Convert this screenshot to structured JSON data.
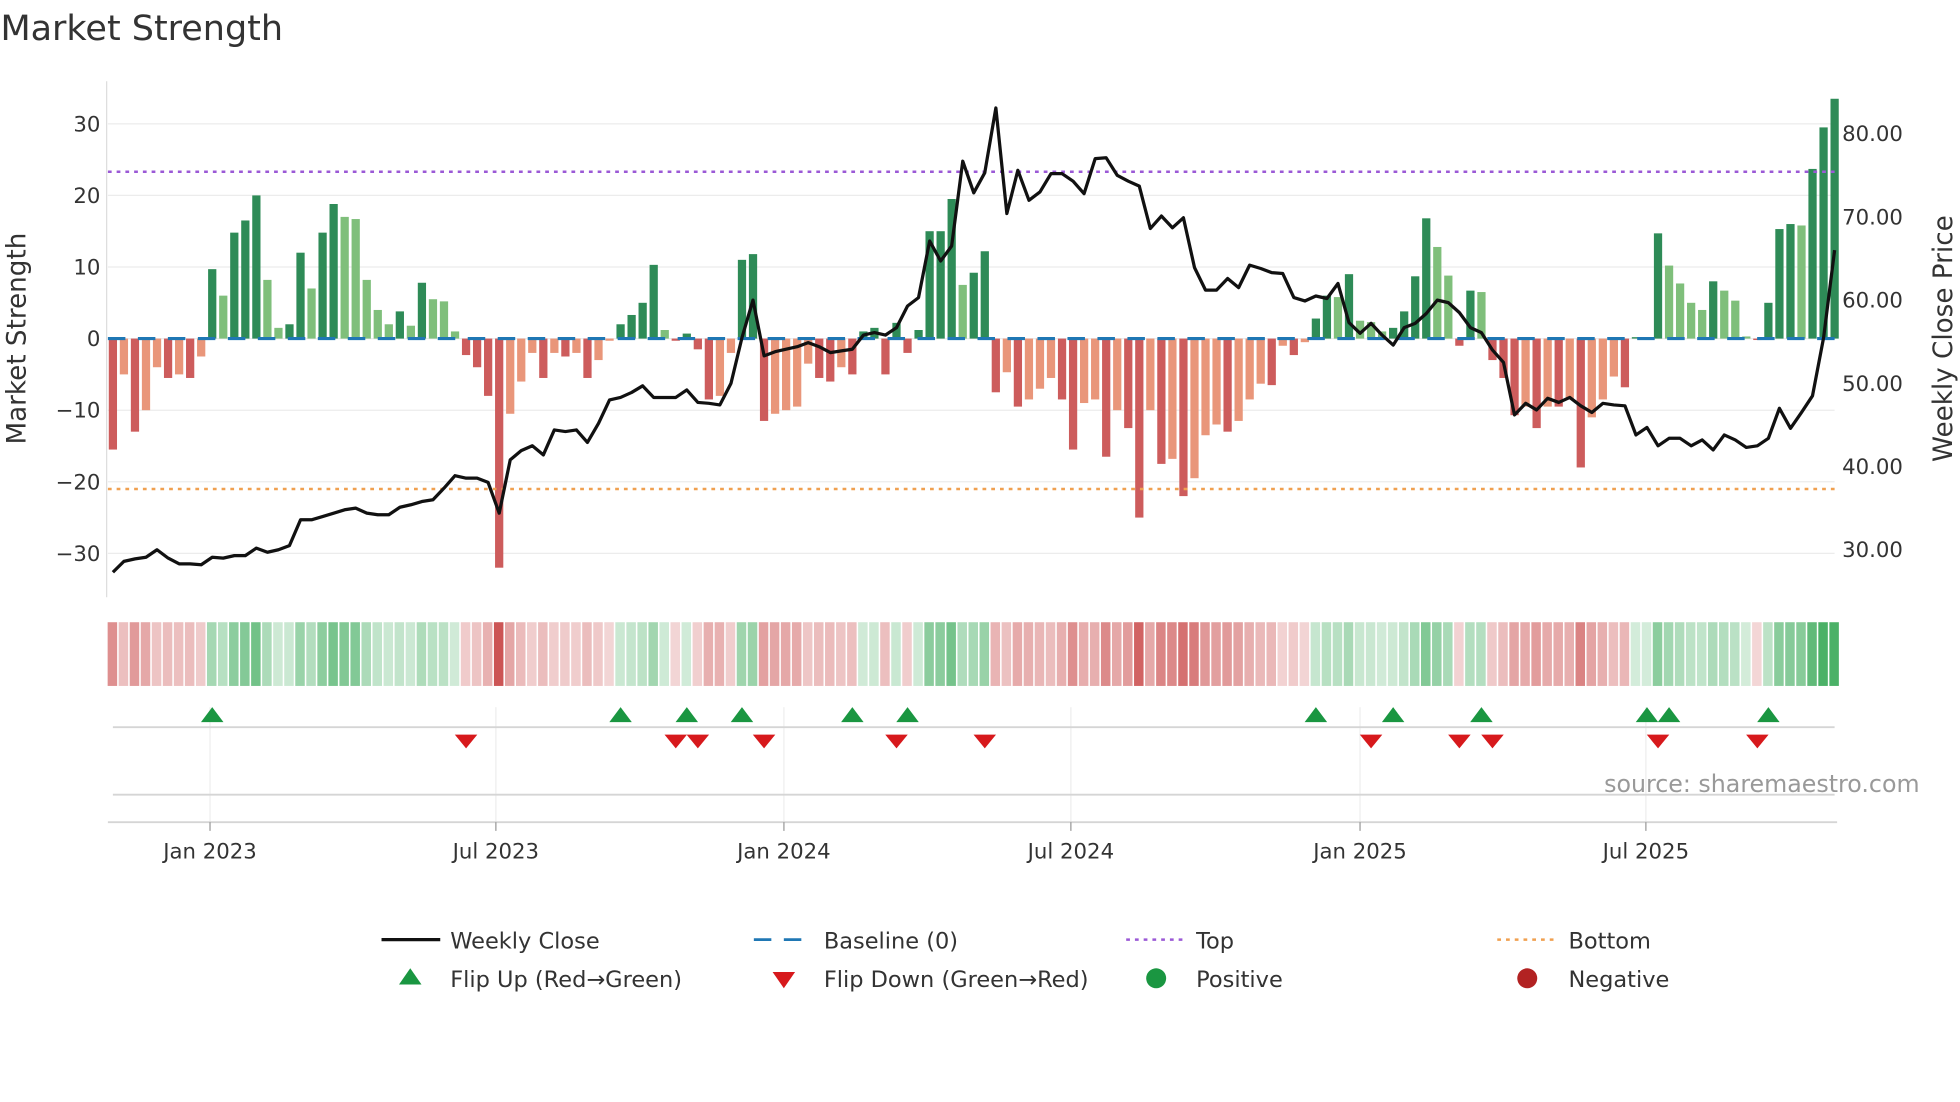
{
  "title": "Market Strength",
  "source": "source: sharemaestro.com",
  "chart_data": {
    "type": "bar",
    "title": "Market Strength",
    "ylabel": "Market Strength",
    "y2label": "Weekly Close Price",
    "ylim": [
      -33,
      35
    ],
    "y2lim": [
      24.3,
      84.5
    ],
    "yticks": [
      "30",
      "20",
      "10",
      "0",
      "−10",
      "−20",
      "−30"
    ],
    "ytick_values": [
      30,
      20,
      10,
      0,
      -10,
      -20,
      -30
    ],
    "y2ticks": [
      "80.00",
      "70.00",
      "60.00",
      "50.00",
      "40.00",
      "30.00"
    ],
    "y2tick_values": [
      80,
      70,
      60,
      50,
      40,
      30
    ],
    "xticks": [
      "Jan 2023",
      "Jul 2023",
      "Jan 2024",
      "Jul 2024",
      "Jan 2025",
      "Jul 2025"
    ],
    "xtick_week_index": [
      8.8,
      34.7,
      60.8,
      86.8,
      113,
      138.9
    ],
    "start_week": "2022-11-04",
    "frequency": "weekly",
    "top": 23.3,
    "bottom": -21,
    "strength": [
      -15.5,
      -5,
      -13,
      -10,
      -4,
      -5.5,
      -5,
      -5.5,
      -2.5,
      9.7,
      6,
      14.8,
      16.5,
      20,
      8.2,
      1.5,
      2,
      12,
      7,
      14.8,
      18.8,
      17,
      16.7,
      8.2,
      4,
      2,
      3.8,
      1.8,
      7.8,
      5.5,
      5.2,
      1,
      -2.3,
      -4,
      -8,
      -32,
      -10.5,
      -6,
      -2,
      -5.5,
      -2,
      -2.5,
      -2,
      -5.5,
      -3,
      -0.3,
      2,
      3.3,
      5,
      10.3,
      1.2,
      -0.3,
      0.7,
      -1.5,
      -8.5,
      -8,
      -2,
      11,
      11.8,
      -11.5,
      -10.5,
      -10,
      -9.5,
      -3.5,
      -5.5,
      -6,
      -4,
      -5,
      1,
      1.5,
      -5,
      2.2,
      -2,
      1.2,
      15,
      15,
      19.5,
      7.5,
      9.2,
      12.2,
      -7.5,
      -4.7,
      -9.5,
      -8.5,
      -7,
      -5.5,
      -8.5,
      -15.5,
      -9,
      -8.5,
      -16.5,
      -10,
      -12.5,
      -25,
      -10,
      -17.5,
      -16.8,
      -22,
      -19.5,
      -13.5,
      -12,
      -13,
      -11.5,
      -8.5,
      -6.3,
      -6.5,
      -1,
      -2.3,
      -0.5,
      2.8,
      6,
      5.8,
      9,
      2.5,
      2.3,
      1,
      1.5,
      3.8,
      8.7,
      16.8,
      12.8,
      8.8,
      -1,
      6.7,
      6.5,
      -3,
      -5.5,
      -10.7,
      -9.5,
      -12.5,
      -9.5,
      -9.5,
      -8.5,
      -18,
      -11,
      -8.5,
      -5.3,
      -6.8,
      0.2,
      0.1,
      14.7,
      10.2,
      7.7,
      5,
      4,
      8,
      6.7,
      5.3,
      0.3,
      -0.2,
      5,
      15.3,
      16,
      15.8,
      23.7,
      29.5,
      33.5
    ],
    "weekly_close": [
      27.3,
      28.6,
      28.9,
      29.1,
      30,
      29,
      28.3,
      28.3,
      28.2,
      29.1,
      29,
      29.3,
      29.3,
      30.2,
      29.7,
      30,
      30.5,
      33.6,
      33.6,
      34,
      34.4,
      34.8,
      35,
      34.4,
      34.2,
      34.2,
      35.1,
      35.4,
      35.8,
      36,
      37.4,
      38.9,
      38.6,
      38.6,
      38.1,
      34.4,
      40.8,
      41.9,
      42.5,
      41.4,
      44.4,
      44.2,
      44.4,
      42.9,
      45.2,
      48,
      48.3,
      48.9,
      49.7,
      48.3,
      48.3,
      48.3,
      49.2,
      47.7,
      47.6,
      47.4,
      50,
      55.5,
      60,
      53.3,
      53.8,
      54.1,
      54.4,
      54.9,
      54.4,
      53.7,
      53.9,
      54.1,
      55.8,
      56.1,
      55.8,
      56.7,
      59.3,
      60.3,
      67.1,
      64.7,
      66.5,
      76.7,
      72.9,
      75.3,
      83.1,
      70.4,
      75.6,
      72,
      73,
      75.2,
      75.2,
      74.3,
      72.8,
      77,
      77.1,
      75,
      74.3,
      73.7,
      68.6,
      70.1,
      68.7,
      69.9,
      63.9,
      61.2,
      61.2,
      62.6,
      61.5,
      64.2,
      63.8,
      63.3,
      63.2,
      60.3,
      59.9,
      60.5,
      60.2,
      62,
      57.3,
      56,
      57.2,
      55.8,
      54.6,
      56.7,
      57.2,
      58.4,
      60,
      59.7,
      58.5,
      56.7,
      56.1,
      54,
      52.5,
      46.2,
      47.6,
      46.8,
      48.2,
      47.7,
      48.3,
      47.3,
      46.5,
      47.6,
      47.4,
      47.3,
      43.8,
      44.7,
      42.5,
      43.4,
      43.4,
      42.5,
      43.2,
      42,
      43.8,
      43.2,
      42.3,
      42.5,
      43.4,
      47,
      44.6,
      46.5,
      48.5,
      55.5,
      66
    ],
    "flip_up_week_index": [
      9,
      46,
      52,
      57,
      67,
      72,
      109,
      116,
      124,
      139,
      141,
      150
    ],
    "flip_down_week_index": [
      32,
      51,
      53,
      59,
      71,
      79,
      114,
      122,
      125,
      140,
      149
    ],
    "legend": {
      "placement": "bottom",
      "weekly_close": "Weekly Close",
      "baseline": "Baseline (0)",
      "top": "Top",
      "bottom": "Bottom",
      "flip_up": "Flip Up (Red→Green)",
      "flip_down": "Flip Down (Green→Red)",
      "positive": "Positive",
      "negative": "Negative"
    },
    "colors": {
      "pos_strong": "#2e8b57",
      "pos_weak": "#7fbf7b",
      "neg_strong": "#cd5c5c",
      "neg_weak": "#e9967a",
      "baseline": "#1f77b4",
      "top": "#9b59d6",
      "bottom": "#f0a050",
      "line": "#111111",
      "flip_up": "#1a9641",
      "flip_down": "#d7191c",
      "positive": "#1a9641",
      "negative": "#b22222"
    }
  }
}
